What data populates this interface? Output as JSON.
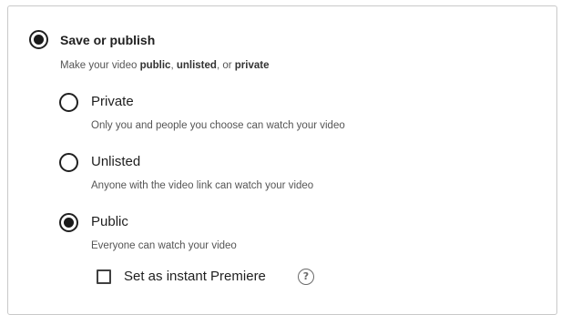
{
  "visibility": {
    "title": "Save or publish",
    "description_prefix": "Make your video ",
    "description_public": "public",
    "description_sep1": ", ",
    "description_unlisted": "unlisted",
    "description_sep2": ", or ",
    "description_private": "private",
    "selected": "public",
    "options": [
      {
        "label": "Private",
        "description": "Only you and people you choose can watch your video",
        "checked": false
      },
      {
        "label": "Unlisted",
        "description": "Anyone with the video link can watch your video",
        "checked": false
      },
      {
        "label": "Public",
        "description": "Everyone can watch your video",
        "checked": true
      }
    ],
    "premiere": {
      "label": "Set as instant Premiere",
      "checked": false,
      "help_icon": "help-circle-icon",
      "help_glyph": "?"
    }
  }
}
